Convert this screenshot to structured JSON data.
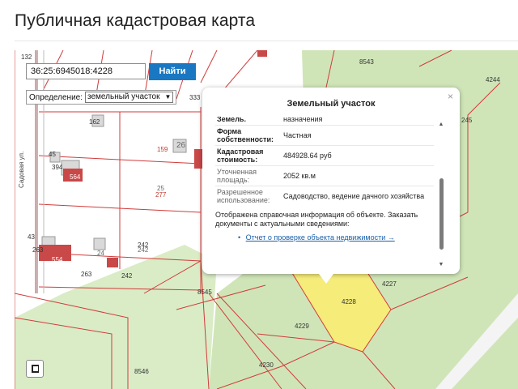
{
  "page": {
    "title": "Публичная кадастровая карта"
  },
  "search": {
    "value": "36:25:6945018:4228",
    "button_label": "Найти"
  },
  "definition": {
    "label": "Определение:",
    "selected": "земельный участок"
  },
  "popup": {
    "title": "Земельный участок",
    "cut_key": "Земель.",
    "cut_value": "назначения",
    "rows": [
      {
        "key": "Форма собственности:",
        "value": "Частная"
      },
      {
        "key": "Кадастровая стоимость:",
        "value": "484928.64 руб"
      },
      {
        "key": "Уточненная площадь:",
        "value": "2052 кв.м"
      },
      {
        "key": "Разрешенное использование:",
        "value": "Садоводство, ведение дачного хозяйства"
      }
    ],
    "note": "Отображена справочная информация об объекте. Заказать документы с актуальными сведениями:",
    "link": "Отчет о проверке объекта недвижимости →",
    "close_glyph": "×"
  },
  "map": {
    "street_label": "Садовая ул.",
    "labels": [
      {
        "text": "8543"
      },
      {
        "text": "4244"
      },
      {
        "text": "245"
      },
      {
        "text": "132"
      },
      {
        "text": "333"
      },
      {
        "text": "162"
      },
      {
        "text": "159"
      },
      {
        "text": "26"
      },
      {
        "text": "394"
      },
      {
        "text": "564"
      },
      {
        "text": "25"
      },
      {
        "text": "277"
      },
      {
        "text": "45"
      },
      {
        "text": "43"
      },
      {
        "text": "263"
      },
      {
        "text": "554"
      },
      {
        "text": "24"
      },
      {
        "text": "242"
      },
      {
        "text": "242"
      },
      {
        "text": "263"
      },
      {
        "text": "242"
      },
      {
        "text": "8545"
      },
      {
        "text": "4227"
      },
      {
        "text": "4228"
      },
      {
        "text": "4229"
      },
      {
        "text": "4230"
      },
      {
        "text": "8546"
      }
    ]
  },
  "colors": {
    "accent": "#1a78c2",
    "parcel_line": "#d23b3b",
    "land": "#cfe5b8",
    "selected_parcel": "#f5ec7a"
  },
  "icons": {
    "layers": "layer-square-icon",
    "pin": "popup-pointer-icon"
  }
}
